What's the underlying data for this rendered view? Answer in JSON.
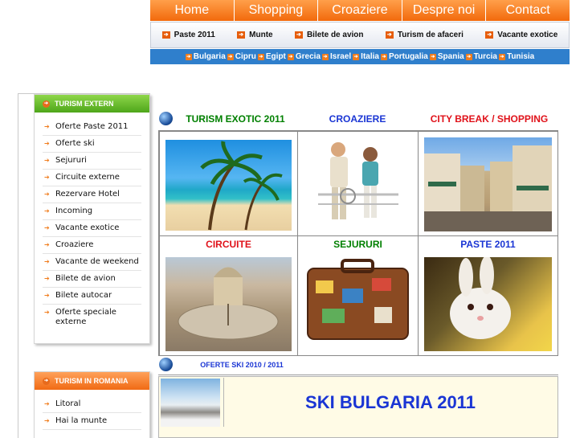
{
  "topnav": {
    "tabs": [
      "Home",
      "Shopping",
      "Croaziere",
      "Despre noi",
      "Contact"
    ]
  },
  "subnav": {
    "items": [
      "Paste 2011",
      "Munte",
      "Bilete de avion",
      "Turism de afaceri",
      "Vacante exotice"
    ]
  },
  "countries": [
    "Bulgaria",
    "Cipru",
    "Egipt",
    "Grecia",
    "Israel",
    "Italia",
    "Portugalia",
    "Spania",
    "Turcia",
    "Tunisia"
  ],
  "sidebar": {
    "extern": {
      "title": "TURISM EXTERN",
      "items": [
        "Oferte Paste 2011",
        "Oferte ski",
        "Sejururi",
        "Circuite externe",
        "Rezervare Hotel",
        "Incoming",
        "Vacante exotice",
        "Croaziere",
        "Vacante de weekend",
        "Bilete de avion",
        "Bilete autocar",
        "Oferte speciale externe"
      ]
    },
    "romania": {
      "title": "TURISM IN ROMANIA",
      "items": [
        "Litoral",
        "Hai la munte"
      ]
    }
  },
  "main": {
    "row1": [
      "TURISM EXOTIC 2011",
      "CROAZIERE",
      "CITY BREAK / SHOPPING"
    ],
    "row2": [
      "CIRCUITE",
      "SEJURURI",
      "PASTE 2011"
    ],
    "ski_header": "OFERTE SKI 2010 / 2011",
    "ski_title": "SKI BULGARIA 2011"
  },
  "colors": {
    "orange": "#f26a0c",
    "green": "#008000",
    "blue": "#1a35d4",
    "red": "#e0121a",
    "country_bar": "#2f7fcc"
  }
}
